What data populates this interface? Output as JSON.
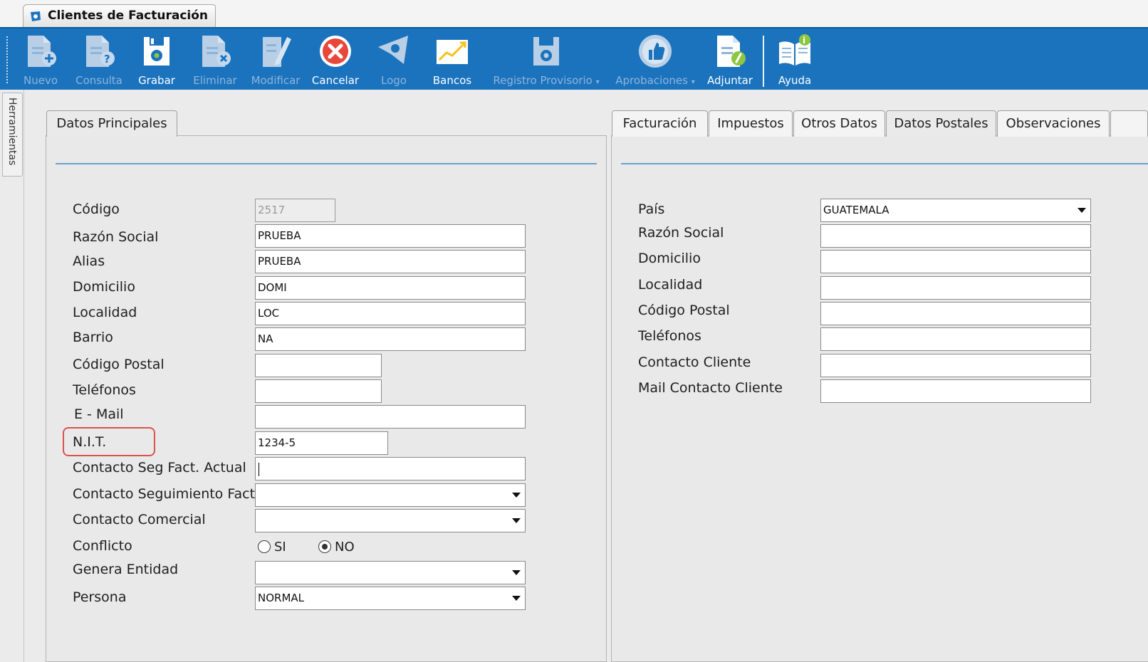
{
  "window": {
    "title": "Clientes de Facturación"
  },
  "toolbar": {
    "buttons": [
      {
        "label": "Nuevo",
        "icon": "new-document-icon",
        "enabled": false
      },
      {
        "label": "Consulta",
        "icon": "query-document-icon",
        "enabled": false
      },
      {
        "label": "Grabar",
        "icon": "save-icon",
        "enabled": true
      },
      {
        "label": "Eliminar",
        "icon": "delete-document-icon",
        "enabled": false
      },
      {
        "label": "Modificar",
        "icon": "edit-document-icon",
        "enabled": false
      },
      {
        "label": "Cancelar",
        "icon": "cancel-icon",
        "enabled": true
      },
      {
        "label": "Logo",
        "icon": "logo-icon",
        "enabled": false
      },
      {
        "label": "Bancos",
        "icon": "chart-icon",
        "enabled": true
      },
      {
        "label": "Registro Provisorio",
        "icon": "save-icon",
        "enabled": false,
        "dropdown": true
      },
      {
        "label": "Aprobaciones",
        "icon": "thumbs-up-icon",
        "enabled": false,
        "dropdown": true
      },
      {
        "label": "Adjuntar",
        "icon": "attach-icon",
        "enabled": true
      },
      {
        "label": "Ayuda",
        "icon": "help-book-icon",
        "enabled": true
      }
    ]
  },
  "side_panel": {
    "label": "Herramientas"
  },
  "left_panel": {
    "tab": "Datos Principales",
    "fields": {
      "codigo": {
        "label": "Código",
        "value": "2517"
      },
      "razon_social": {
        "label": "Razón Social",
        "value": "PRUEBA"
      },
      "alias": {
        "label": "Alias",
        "value": "PRUEBA"
      },
      "domicilio": {
        "label": "Domicilio",
        "value": "DOMI"
      },
      "localidad": {
        "label": "Localidad",
        "value": "LOC"
      },
      "barrio": {
        "label": "Barrio",
        "value": "NA"
      },
      "codigo_postal": {
        "label": "Código Postal",
        "value": ""
      },
      "telefonos": {
        "label": "Teléfonos",
        "value": ""
      },
      "email": {
        "label": "E - Mail",
        "value": ""
      },
      "nit": {
        "label": "N.I.T.",
        "value": "1234-5"
      },
      "contacto_seg_actual": {
        "label": "Contacto Seg Fact. Actual",
        "value": ""
      },
      "contacto_seguimiento": {
        "label": "Contacto Seguimiento Fact.",
        "value": ""
      },
      "contacto_comercial": {
        "label": "Contacto Comercial",
        "value": ""
      },
      "conflicto": {
        "label": "Conflicto",
        "options": [
          "SI",
          "NO"
        ],
        "selected": "NO"
      },
      "genera_entidad": {
        "label": "Genera Entidad",
        "value": ""
      },
      "persona": {
        "label": "Persona",
        "value": "NORMAL"
      }
    }
  },
  "right_panel": {
    "tabs": [
      "Facturación",
      "Impuestos",
      "Otros Datos",
      "Datos Postales",
      "Observaciones"
    ],
    "active_tab": "Datos Postales",
    "fields": {
      "pais": {
        "label": "País",
        "value": "GUATEMALA"
      },
      "razon_social": {
        "label": "Razón Social",
        "value": ""
      },
      "domicilio": {
        "label": "Domicilio",
        "value": ""
      },
      "localidad": {
        "label": "Localidad",
        "value": ""
      },
      "codigo_postal": {
        "label": "Código Postal",
        "value": ""
      },
      "telefonos": {
        "label": "Teléfonos",
        "value": ""
      },
      "contacto_cliente": {
        "label": "Contacto Cliente",
        "value": ""
      },
      "mail_contacto_cliente": {
        "label": "Mail Contacto Cliente",
        "value": ""
      }
    }
  },
  "colors": {
    "toolbar": "#1b73be",
    "highlight": "#d9534f",
    "cancel": "#e8473a"
  }
}
